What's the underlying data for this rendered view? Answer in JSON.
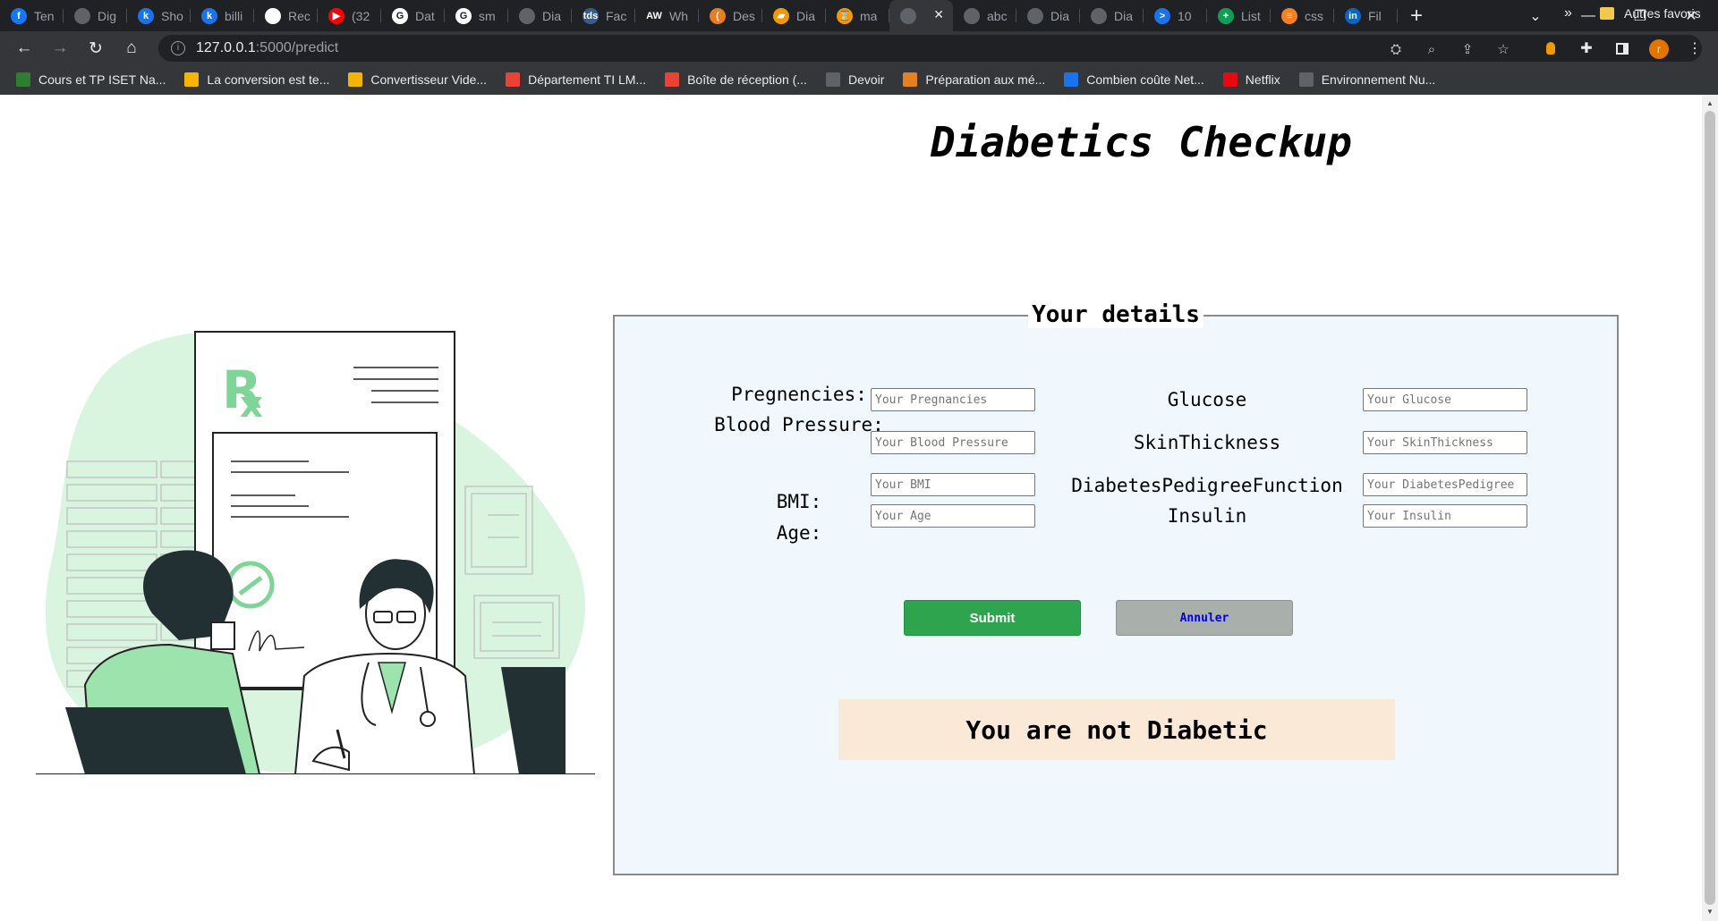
{
  "browser": {
    "tabs": [
      {
        "title": "Ten",
        "icon": "facebook-icon",
        "color": "#1877f2",
        "glyph": "f"
      },
      {
        "title": "Dig",
        "icon": "globe-icon",
        "color": "#5f6368",
        "glyph": ""
      },
      {
        "title": "Sho",
        "icon": "k-logo-icon",
        "color": "#1a73e8",
        "glyph": "k"
      },
      {
        "title": "billi",
        "icon": "k-logo-icon",
        "color": "#1a73e8",
        "glyph": "k"
      },
      {
        "title": "Rec",
        "icon": "github-icon",
        "color": "#ffffff",
        "glyph": ""
      },
      {
        "title": "(32",
        "icon": "youtube-icon",
        "color": "#ff0000",
        "glyph": "▶"
      },
      {
        "title": "Dat",
        "icon": "google-icon",
        "color": "#ffffff",
        "glyph": "G"
      },
      {
        "title": "sm",
        "icon": "google-icon",
        "color": "#ffffff",
        "glyph": "G"
      },
      {
        "title": "Dia",
        "icon": "globe-icon",
        "color": "#5f6368",
        "glyph": ""
      },
      {
        "title": "Fac",
        "icon": "tds-icon",
        "color": "#355e8c",
        "glyph": "tds"
      },
      {
        "title": "Wh",
        "icon": "aw-logo-icon",
        "color": "#202124",
        "glyph": "AW"
      },
      {
        "title": "Des",
        "icon": "arc-icon",
        "color": "#e67e22",
        "glyph": "("
      },
      {
        "title": "Dia",
        "icon": "book-icon",
        "color": "#f29900",
        "glyph": "▰"
      },
      {
        "title": "ma",
        "icon": "hourglass-icon",
        "color": "#f29900",
        "glyph": "⌛"
      },
      {
        "title": "",
        "icon": "globe-icon",
        "color": "#5f6368",
        "glyph": ""
      },
      {
        "title": "abc",
        "icon": "globe-icon",
        "color": "#5f6368",
        "glyph": ""
      },
      {
        "title": "Dia",
        "icon": "globe-icon",
        "color": "#5f6368",
        "glyph": ""
      },
      {
        "title": "Dia",
        "icon": "globe-icon",
        "color": "#5f6368",
        "glyph": ""
      },
      {
        "title": "10",
        "icon": "terminal-icon",
        "color": "#1a73e8",
        "glyph": ">"
      },
      {
        "title": "List",
        "icon": "sheets-icon",
        "color": "#0f9d58",
        "glyph": "+"
      },
      {
        "title": "css",
        "icon": "stackoverflow-icon",
        "color": "#f48024",
        "glyph": "≡"
      },
      {
        "title": "Fil",
        "icon": "linkedin-icon",
        "color": "#0a66c2",
        "glyph": "in"
      }
    ],
    "active_tab_index": 14,
    "url_host": "127.0.0.1",
    "url_path": ":5000/predict",
    "bookmarks": [
      {
        "label": "Cours et TP ISET Na...",
        "icon": "iset-icon",
        "color": "#2e7d32"
      },
      {
        "label": "La conversion est te...",
        "icon": "film-icon",
        "color": "#f4b400"
      },
      {
        "label": "Convertisseur Vide...",
        "icon": "film-icon",
        "color": "#f4b400"
      },
      {
        "label": "Département TI LM...",
        "icon": "gmail-icon",
        "color": "#ea4335"
      },
      {
        "label": "Boîte de réception (...",
        "icon": "gmail-icon",
        "color": "#ea4335"
      },
      {
        "label": "Devoir",
        "icon": "m-logo-icon",
        "color": "#5f6368"
      },
      {
        "label": "Préparation aux mé...",
        "icon": "m-logo-icon",
        "color": "#e67e22"
      },
      {
        "label": "Combien coûte Net...",
        "icon": "b-logo-icon",
        "color": "#1a73e8"
      },
      {
        "label": "Netflix",
        "icon": "netflix-icon",
        "color": "#e50914"
      },
      {
        "label": "Environnement Nu...",
        "icon": "m-logo-icon",
        "color": "#5f6368"
      }
    ],
    "bookmarks_more": "»",
    "other_bookmarks": "Autres favoris",
    "profile_initial": "r"
  },
  "page": {
    "title": "Diabetics Checkup",
    "form": {
      "legend": "Your details",
      "left_fields": [
        {
          "label": "Pregnencies:",
          "placeholder": "Your Pregnancies"
        },
        {
          "label": "Blood Pressure:",
          "placeholder": "Your Blood Pressure"
        },
        {
          "label": "BMI:",
          "placeholder": "Your BMI"
        },
        {
          "label": "Age:",
          "placeholder": "Your Age"
        }
      ],
      "right_fields": [
        {
          "label": "Glucose",
          "placeholder": "Your Glucose"
        },
        {
          "label": "SkinThickness",
          "placeholder": "Your SkinThickness"
        },
        {
          "label": "DiabetesPedigreeFunction",
          "placeholder": "Your DiabetesPedigree"
        },
        {
          "label": "Insulin",
          "placeholder": "Your Insulin"
        }
      ],
      "submit_label": "Submit",
      "cancel_label": "Annuler"
    },
    "result": "You are not Diabetic",
    "colors": {
      "accent_green": "#2ea44f",
      "illustration_green": "#9de3ad",
      "form_background": "#f0f7fd",
      "result_background": "#fbe9d8"
    }
  }
}
